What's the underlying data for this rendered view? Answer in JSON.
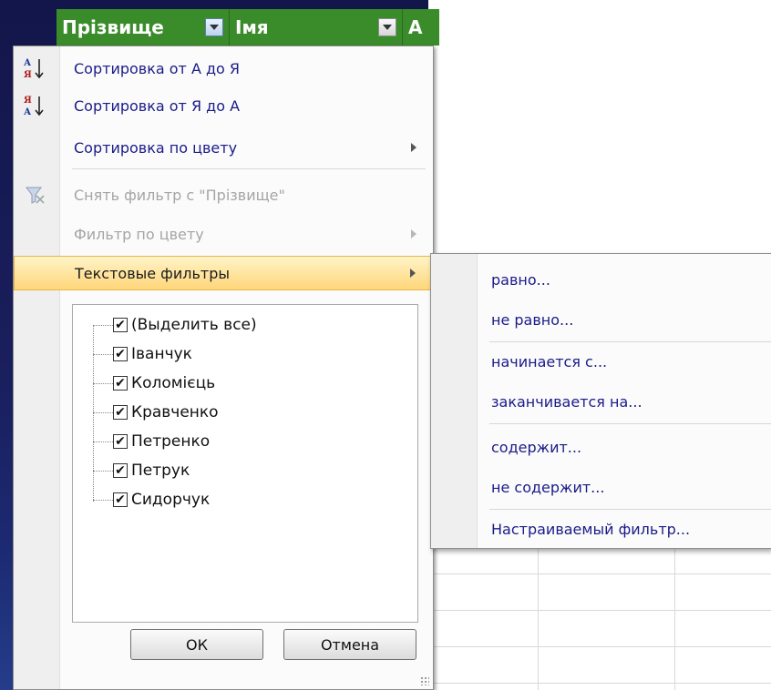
{
  "header": {
    "col1": "Прізвище",
    "col2": "Імя",
    "col3": "А"
  },
  "menu": {
    "sort_az": "Сортировка от А до Я",
    "sort_za": "Сортировка от Я до А",
    "sort_color": "Сортировка по цвету",
    "clear_filter": "Снять фильтр с \"Прізвище\"",
    "filter_color": "Фильтр по цвету",
    "text_filters": "Текстовые фильтры"
  },
  "list": {
    "items": [
      "(Выделить все)",
      "Іванчук",
      "Коломієць",
      "Кравченко",
      "Петренко",
      "Петрук",
      "Сидорчук"
    ]
  },
  "buttons": {
    "ok": "ОК",
    "cancel": "Отмена"
  },
  "submenu": {
    "items": [
      "равно...",
      "не равно...",
      "начинается с...",
      "заканчивается на...",
      "содержит...",
      "не содержит...",
      "Настраиваемый фильтр..."
    ]
  },
  "icons": {
    "sort_az": "sort-ascending-icon",
    "sort_za": "sort-descending-icon",
    "clear_filter": "clear-filter-icon",
    "dropdown": "chevron-down-icon",
    "checkbox": "checkmark-icon"
  },
  "colors": {
    "header_bg": "#3a8c2a",
    "highlight": "#ffd67a",
    "menu_text": "#1b1b8a"
  }
}
